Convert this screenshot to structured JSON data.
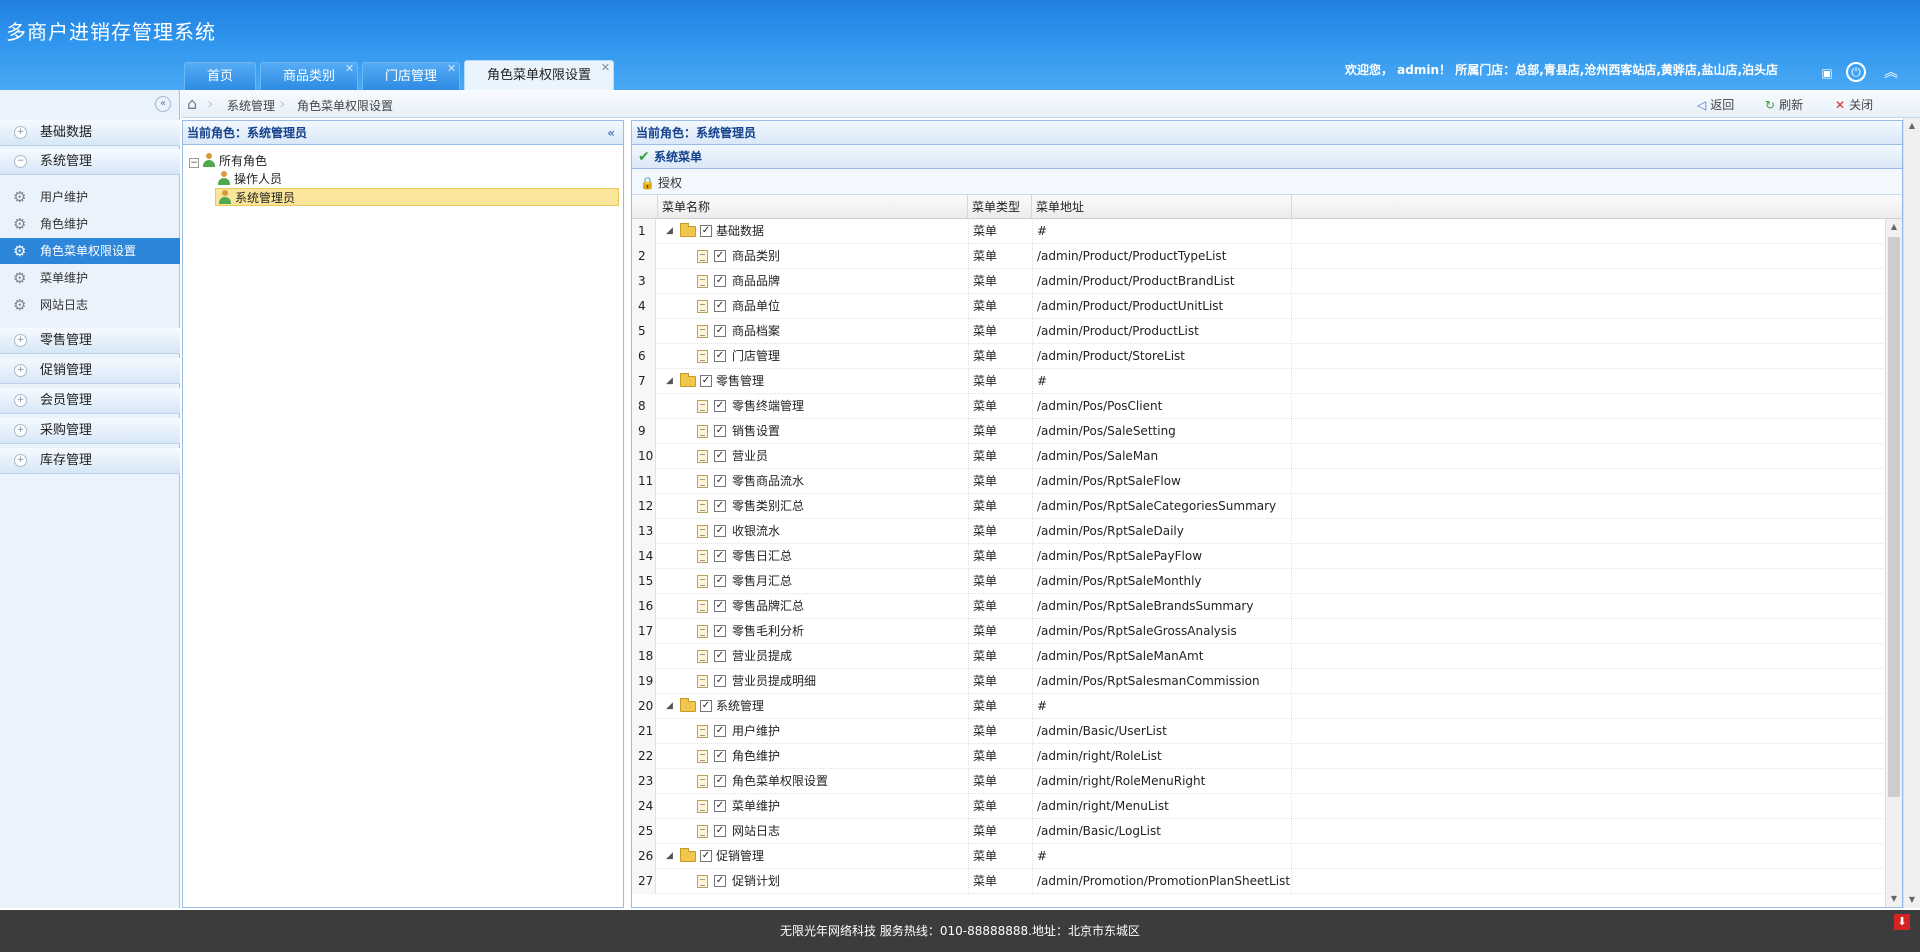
{
  "app_title": "多商户进销存管理系统",
  "tabs": [
    {
      "label": "首页",
      "closable": false
    },
    {
      "label": "商品类别",
      "closable": true
    },
    {
      "label": "门店管理",
      "closable": true
    },
    {
      "label": "角色菜单权限设置",
      "closable": true,
      "active": true
    }
  ],
  "header": {
    "welcome": "欢迎您， admin！ 所属门店：总部,青县店,沧州西客站店,黄骅店,盐山店,泊头店",
    "icons": [
      "clipboard-icon",
      "power-icon",
      "collapse-up-icon"
    ]
  },
  "sidebar": {
    "groups": [
      {
        "label": "基础数据"
      },
      {
        "label": "系统管理"
      },
      {
        "label": "零售管理"
      },
      {
        "label": "促销管理"
      },
      {
        "label": "会员管理"
      },
      {
        "label": "采购管理"
      },
      {
        "label": "库存管理"
      }
    ],
    "items": [
      {
        "label": "用户维护"
      },
      {
        "label": "角色维护"
      },
      {
        "label": "角色菜单权限设置",
        "selected": true
      },
      {
        "label": "菜单维护"
      },
      {
        "label": "网站日志"
      }
    ]
  },
  "breadcrumb": {
    "items": [
      "系统管理",
      "角色菜单权限设置"
    ],
    "back": "返回",
    "refresh": "刷新",
    "close": "关闭"
  },
  "left_panel": {
    "title": "当前角色：系统管理员",
    "tree": {
      "root": "所有角色",
      "children": [
        {
          "label": "操作人员"
        },
        {
          "label": "系统管理员",
          "selected": true
        }
      ]
    }
  },
  "right_panel": {
    "title": "当前角色：系统管理员",
    "sub_title": "系统菜单",
    "toolbar": {
      "authorize": "授权"
    },
    "columns": [
      "菜单名称",
      "菜单类型",
      "菜单地址"
    ],
    "rows": [
      {
        "n": "1",
        "name": "基础数据",
        "type": "菜单",
        "url": "#",
        "level": 0
      },
      {
        "n": "2",
        "name": "商品类别",
        "type": "菜单",
        "url": "/admin/Product/ProductTypeList",
        "level": 1
      },
      {
        "n": "3",
        "name": "商品品牌",
        "type": "菜单",
        "url": "/admin/Product/ProductBrandList",
        "level": 1
      },
      {
        "n": "4",
        "name": "商品单位",
        "type": "菜单",
        "url": "/admin/Product/ProductUnitList",
        "level": 1
      },
      {
        "n": "5",
        "name": "商品档案",
        "type": "菜单",
        "url": "/admin/Product/ProductList",
        "level": 1
      },
      {
        "n": "6",
        "name": "门店管理",
        "type": "菜单",
        "url": "/admin/Product/StoreList",
        "level": 1
      },
      {
        "n": "7",
        "name": "零售管理",
        "type": "菜单",
        "url": "#",
        "level": 0
      },
      {
        "n": "8",
        "name": "零售终端管理",
        "type": "菜单",
        "url": "/admin/Pos/PosClient",
        "level": 1
      },
      {
        "n": "9",
        "name": "销售设置",
        "type": "菜单",
        "url": "/admin/Pos/SaleSetting",
        "level": 1
      },
      {
        "n": "10",
        "name": "营业员",
        "type": "菜单",
        "url": "/admin/Pos/SaleMan",
        "level": 1
      },
      {
        "n": "11",
        "name": "零售商品流水",
        "type": "菜单",
        "url": "/admin/Pos/RptSaleFlow",
        "level": 1
      },
      {
        "n": "12",
        "name": "零售类别汇总",
        "type": "菜单",
        "url": "/admin/Pos/RptSaleCategoriesSummary",
        "level": 1
      },
      {
        "n": "13",
        "name": "收银流水",
        "type": "菜单",
        "url": "/admin/Pos/RptSaleDaily",
        "level": 1
      },
      {
        "n": "14",
        "name": "零售日汇总",
        "type": "菜单",
        "url": "/admin/Pos/RptSalePayFlow",
        "level": 1
      },
      {
        "n": "15",
        "name": "零售月汇总",
        "type": "菜单",
        "url": "/admin/Pos/RptSaleMonthly",
        "level": 1
      },
      {
        "n": "16",
        "name": "零售品牌汇总",
        "type": "菜单",
        "url": "/admin/Pos/RptSaleBrandsSummary",
        "level": 1
      },
      {
        "n": "17",
        "name": "零售毛利分析",
        "type": "菜单",
        "url": "/admin/Pos/RptSaleGrossAnalysis",
        "level": 1
      },
      {
        "n": "18",
        "name": "营业员提成",
        "type": "菜单",
        "url": "/admin/Pos/RptSaleManAmt",
        "level": 1
      },
      {
        "n": "19",
        "name": "营业员提成明细",
        "type": "菜单",
        "url": "/admin/Pos/RptSalesmanCommission",
        "level": 1
      },
      {
        "n": "20",
        "name": "系统管理",
        "type": "菜单",
        "url": "#",
        "level": 0
      },
      {
        "n": "21",
        "name": "用户维护",
        "type": "菜单",
        "url": "/admin/Basic/UserList",
        "level": 1
      },
      {
        "n": "22",
        "name": "角色维护",
        "type": "菜单",
        "url": "/admin/right/RoleList",
        "level": 1
      },
      {
        "n": "23",
        "name": "角色菜单权限设置",
        "type": "菜单",
        "url": "/admin/right/RoleMenuRight",
        "level": 1
      },
      {
        "n": "24",
        "name": "菜单维护",
        "type": "菜单",
        "url": "/admin/right/MenuList",
        "level": 1
      },
      {
        "n": "25",
        "name": "网站日志",
        "type": "菜单",
        "url": "/admin/Basic/LogList",
        "level": 1
      },
      {
        "n": "26",
        "name": "促销管理",
        "type": "菜单",
        "url": "#",
        "level": 0
      },
      {
        "n": "27",
        "name": "促销计划",
        "type": "菜单",
        "url": "/admin/Promotion/PromotionPlanSheetList",
        "level": 1
      }
    ]
  },
  "footer": {
    "text": "无限光年网络科技 服务热线：010-88888888.地址：北京市东城区"
  }
}
